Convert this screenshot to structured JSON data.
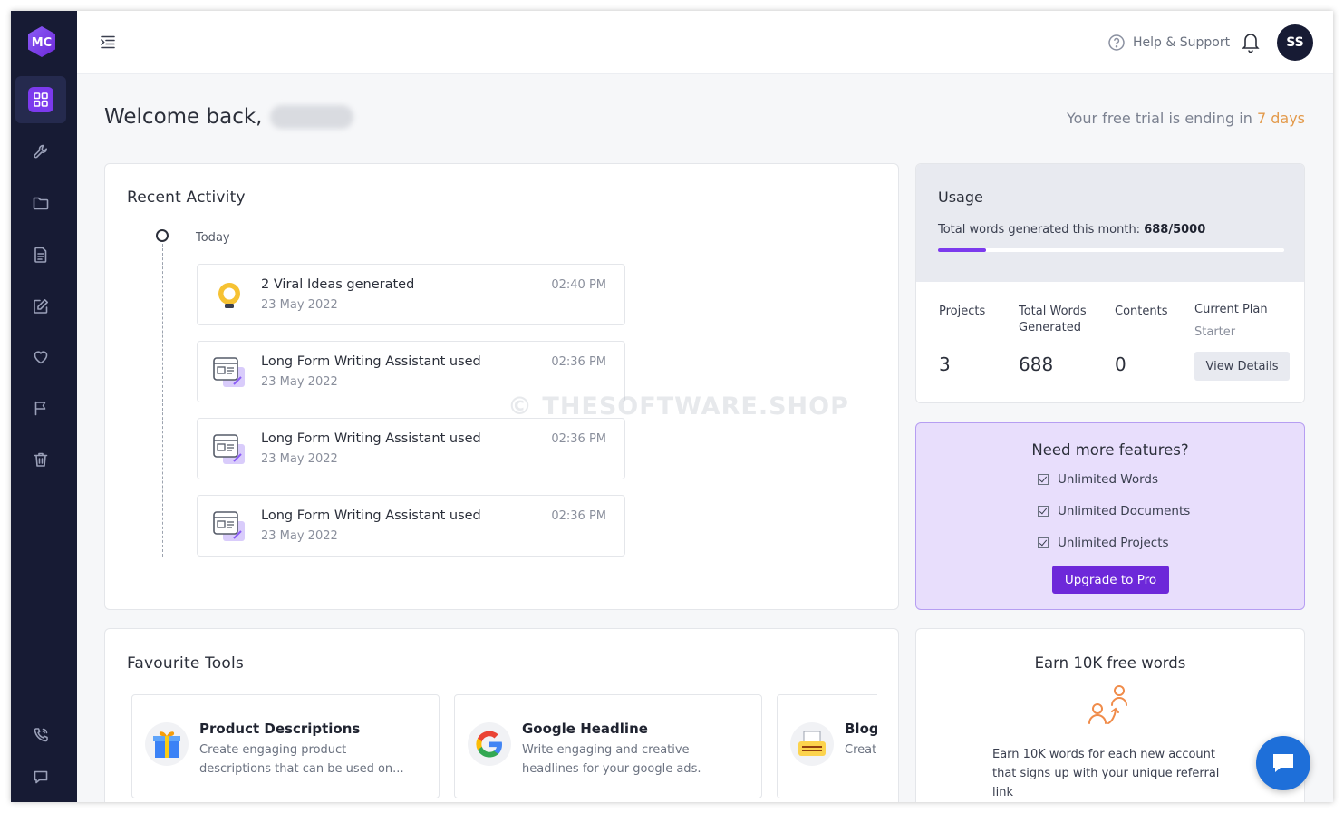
{
  "sidebar": {
    "logo_text": "MC",
    "nav": [
      {
        "icon": "dashboard-icon",
        "active": true
      },
      {
        "icon": "tools-icon",
        "active": false
      },
      {
        "icon": "folder-icon",
        "active": false
      },
      {
        "icon": "document-icon",
        "active": false
      },
      {
        "icon": "edit-icon",
        "active": false
      },
      {
        "icon": "heart-icon",
        "active": false
      },
      {
        "icon": "flag-icon",
        "active": false
      },
      {
        "icon": "trash-icon",
        "active": false
      }
    ],
    "bottom": [
      {
        "icon": "phone-icon"
      },
      {
        "icon": "chat-icon"
      }
    ]
  },
  "topbar": {
    "help_label": "Help & Support",
    "avatar_initials": "SS"
  },
  "welcome": {
    "greeting": "Welcome back,",
    "trial_prefix": "Your free trial is ending in",
    "trial_days": "7 days"
  },
  "recent_activity": {
    "title": "Recent Activity",
    "group_label": "Today",
    "items": [
      {
        "title": "2 Viral Ideas generated",
        "date": "23 May 2022",
        "time": "02:40 PM",
        "icon": "lightbulb-icon"
      },
      {
        "title": "Long Form Writing Assistant used",
        "date": "23 May 2022",
        "time": "02:36 PM",
        "icon": "writing-assistant-icon"
      },
      {
        "title": "Long Form Writing Assistant used",
        "date": "23 May 2022",
        "time": "02:36 PM",
        "icon": "writing-assistant-icon"
      },
      {
        "title": "Long Form Writing Assistant used",
        "date": "23 May 2022",
        "time": "02:36 PM",
        "icon": "writing-assistant-icon"
      }
    ]
  },
  "watermark": "© THESOFTWARE.SHOP",
  "usage": {
    "title": "Usage",
    "words_label": "Total words generated this month:",
    "words_value": "688/5000",
    "progress_fraction": 0.1376,
    "stats": [
      {
        "label": "Projects",
        "value": "3"
      },
      {
        "label": "Total Words Generated",
        "value": "688"
      },
      {
        "label": "Contents",
        "value": "0"
      }
    ],
    "plan_label": "Current Plan",
    "plan_value": "Starter",
    "details_button": "View Details"
  },
  "upgrade": {
    "title": "Need more features?",
    "features": [
      "Unlimited Words",
      "Unlimited Documents",
      "Unlimited Projects"
    ],
    "button": "Upgrade to Pro"
  },
  "favourite_tools": {
    "title": "Favourite Tools",
    "tools": [
      {
        "title": "Product Descriptions",
        "desc": "Create engaging product descriptions that can be used on...",
        "icon": "gift-icon"
      },
      {
        "title": "Google Headline",
        "desc": "Write engaging and creative headlines for your google ads.",
        "icon": "google-icon"
      },
      {
        "title": "Blog",
        "desc": "Creat your b",
        "icon": "typewriter-icon"
      }
    ]
  },
  "earn": {
    "title": "Earn 10K free words",
    "desc": "Earn 10K words for each new account that signs up with your unique referral link"
  },
  "colors": {
    "accent": "#7c3aed",
    "sidebar_bg": "#171b34",
    "trial_days": "#e39a4b",
    "chat_fab": "#1e6fd9"
  }
}
